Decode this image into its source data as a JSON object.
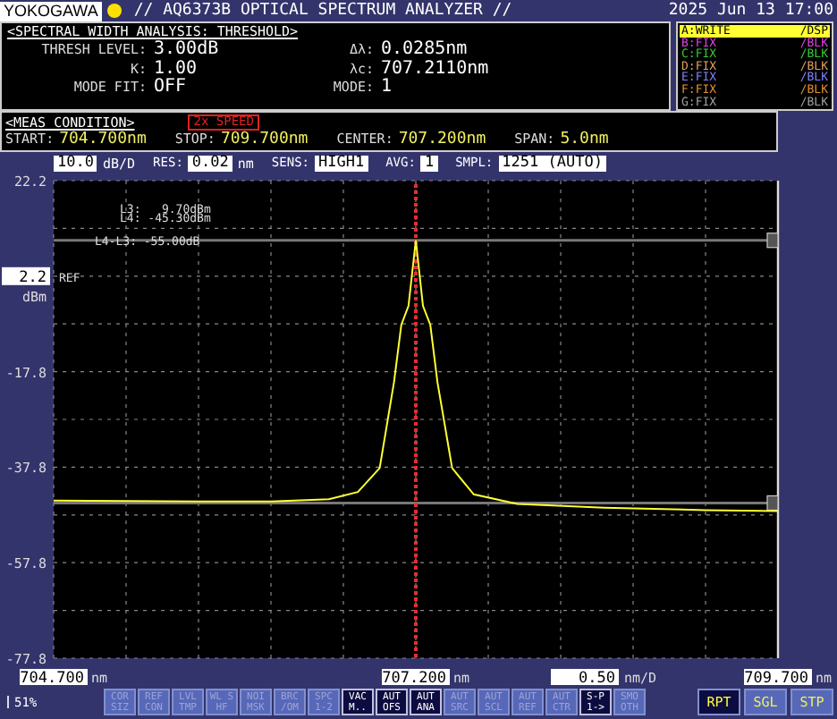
{
  "header": {
    "logo": "YOKOGAWA",
    "title": "// AQ6373B OPTICAL SPECTRUM ANALYZER //",
    "datetime": "2025 Jun 13 17:00"
  },
  "analysis": {
    "heading": "<SPECTRAL WIDTH ANALYSIS: THRESHOLD>",
    "left_fields": [
      {
        "label": "THRESH LEVEL:",
        "value": "3.00dB"
      },
      {
        "label": "K:",
        "value": "1.00"
      },
      {
        "label": "MODE FIT:",
        "value": "OFF"
      }
    ],
    "right_fields": [
      {
        "label": "Δλ:",
        "value": "0.0285nm"
      },
      {
        "label": "λc:",
        "value": "707.2110nm"
      },
      {
        "label": "MODE:",
        "value": "1"
      }
    ]
  },
  "traces": [
    {
      "name": "A:WRITE",
      "mode": "/DSP",
      "selected": true,
      "color": "#ffff33"
    },
    {
      "name": "B:FIX",
      "mode": "/BLK",
      "selected": false,
      "color": "#e040e0"
    },
    {
      "name": "C:FIX",
      "mode": "/BLK",
      "selected": false,
      "color": "#33cc33"
    },
    {
      "name": "D:FIX",
      "mode": "/BLK",
      "selected": false,
      "color": "#e0a060"
    },
    {
      "name": "E:FIX",
      "mode": "/BLK",
      "selected": false,
      "color": "#8080ff"
    },
    {
      "name": "F:FIX",
      "mode": "/BLK",
      "selected": false,
      "color": "#e09030"
    },
    {
      "name": "G:FIX",
      "mode": "/BLK",
      "selected": false,
      "color": "#a0a0a0"
    }
  ],
  "meas_condition": {
    "heading": "<MEAS CONDITION>",
    "badge": "2x SPEED",
    "fields": [
      {
        "label": "START:",
        "value": "704.700nm"
      },
      {
        "label": "STOP:",
        "value": "709.700nm"
      },
      {
        "label": "CENTER:",
        "value": "707.200nm"
      },
      {
        "label": "SPAN:",
        "value": "5.0nm"
      }
    ]
  },
  "settings": [
    {
      "value": "10.0",
      "unit": "dB/D"
    },
    {
      "label": "RES:",
      "value": "0.02",
      "unit": "nm"
    },
    {
      "label": "SENS:",
      "value": "HIGH1"
    },
    {
      "label": "AVG:",
      "value": "1"
    },
    {
      "label": "SMPL:",
      "value": "1251 (AUTO)"
    }
  ],
  "ref": {
    "value": "2.2",
    "unit": "dBm",
    "tag": "REF"
  },
  "marker_readouts": [
    "L3:   9.70dBm",
    "L4: -45.30dBm",
    "L4-L3: -55.00dB"
  ],
  "chart_data": {
    "type": "line",
    "xlim": [
      704.7,
      709.7
    ],
    "ylim": [
      -77.8,
      22.2
    ],
    "yticks": [
      {
        "value": 22.2,
        "label": "22.2"
      },
      {
        "value": -17.8,
        "label": "-17.8"
      },
      {
        "value": -37.8,
        "label": "-37.8"
      },
      {
        "value": -57.8,
        "label": "-57.8"
      },
      {
        "value": -77.8,
        "label": "-77.8"
      }
    ],
    "grid": true,
    "ref_lines": [
      {
        "axis": "y",
        "value": 9.7,
        "color": "#777777"
      },
      {
        "axis": "y",
        "value": -45.3,
        "color": "#777777"
      },
      {
        "axis": "x",
        "value": 707.2,
        "color": "#e03030"
      }
    ],
    "xticks": [
      {
        "value": 704.7,
        "label": "704.700"
      },
      {
        "value": 707.2,
        "label": "707.200"
      },
      {
        "value": 709.7,
        "label": "709.700"
      }
    ],
    "x": [
      704.7,
      705.7,
      706.2,
      706.6,
      706.8,
      706.95,
      707.05,
      707.1,
      707.15,
      707.2,
      707.25,
      707.3,
      707.35,
      707.45,
      707.6,
      707.9,
      708.5,
      709.2,
      709.7
    ],
    "series": [
      {
        "color": "#ffff33",
        "values": [
          -44.8,
          -45.0,
          -45.0,
          -44.5,
          -43,
          -38,
          -20,
          -8,
          -4,
          9.7,
          -4,
          -8,
          -20,
          -38,
          -43.5,
          -45.5,
          -46.3,
          -46.8,
          -47.0
        ]
      }
    ]
  },
  "x_tick_units": [
    "nm",
    "nm",
    "nm"
  ],
  "x_division": {
    "value": "0.50",
    "unit": "nm/D"
  },
  "memory": "51%",
  "softkeys": [
    {
      "label": "COR SIZ",
      "enabled": false
    },
    {
      "label": "REF CON",
      "enabled": false
    },
    {
      "label": "LVL TMP",
      "enabled": false
    },
    {
      "label": "WL SHF",
      "enabled": false
    },
    {
      "label": "NOI MSK",
      "enabled": false
    },
    {
      "label": "BRC /OM",
      "enabled": false
    },
    {
      "label": "SPC 1-2",
      "enabled": false
    },
    {
      "label": "VAC M..",
      "enabled": true
    },
    {
      "label": "AUT OFS",
      "enabled": true
    },
    {
      "label": "AUT ANA",
      "enabled": true
    },
    {
      "label": "AUT SRC",
      "enabled": false
    },
    {
      "label": "AUT SCL",
      "enabled": false
    },
    {
      "label": "AUT REF",
      "enabled": false
    },
    {
      "label": "AUT CTR",
      "enabled": false
    },
    {
      "label": "S-P 1->",
      "enabled": true
    },
    {
      "label": "SMO OTH",
      "enabled": false
    }
  ],
  "mode_keys": [
    {
      "label": "RPT",
      "selected": true
    },
    {
      "label": "SGL",
      "selected": false
    },
    {
      "label": "STP",
      "selected": false
    }
  ]
}
